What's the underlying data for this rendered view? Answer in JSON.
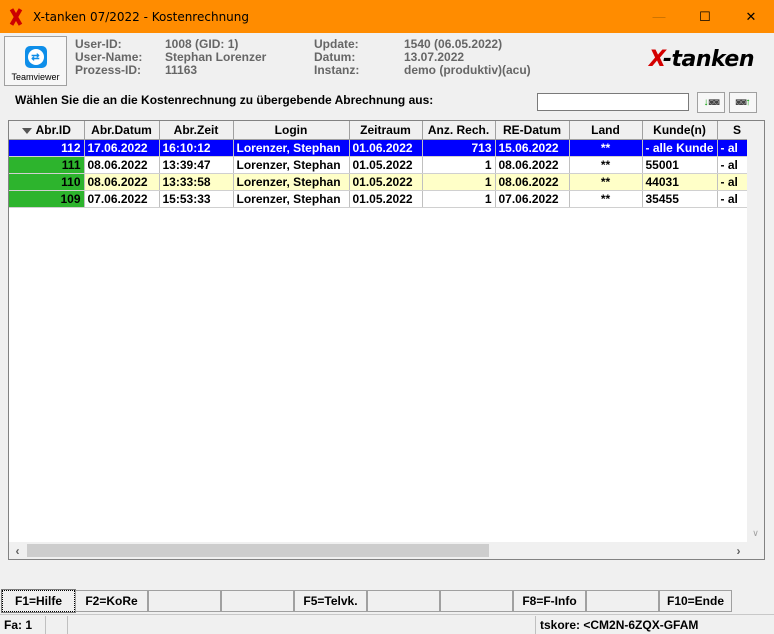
{
  "window": {
    "title": "X-tanken 07/2022 - Kostenrechnung",
    "minimize": "—",
    "maximize": "☐",
    "close": "✕"
  },
  "header": {
    "teamviewer_label": "Teamviewer",
    "user_id_label": "User-ID:",
    "user_id": "1008 (GID: 1)",
    "user_name_label": "User-Name:",
    "user_name": "Stephan Lorenzer",
    "process_id_label": "Prozess-ID:",
    "process_id": "11163",
    "update_label": "Update:",
    "update": "1540 (06.05.2022)",
    "date_label": "Datum:",
    "date": "13.07.2022",
    "instance_label": "Instanz:",
    "instance": "demo (produktiv)(acu)",
    "brand_x": "X",
    "brand_rest": "-tanken"
  },
  "prompt": {
    "text": "Wählen Sie die an die Kostenrechnung zu übergebende Abrechnung aus:",
    "search_value": ""
  },
  "grid": {
    "columns": [
      "Abr.ID",
      "Abr.Datum",
      "Abr.Zeit",
      "Login",
      "Zeitraum",
      "Anz. Rech.",
      "RE-Datum",
      "Land",
      "Kunde(n)",
      "S"
    ],
    "rows": [
      [
        "112",
        "17.06.2022",
        "16:10:12",
        "Lorenzer, Stephan",
        "01.06.2022",
        "713",
        "15.06.2022",
        "**",
        "- alle Kunde",
        "- al"
      ],
      [
        "111",
        "08.06.2022",
        "13:39:47",
        "Lorenzer, Stephan",
        "01.05.2022",
        "1",
        "08.06.2022",
        "**",
        "55001",
        "- al"
      ],
      [
        "110",
        "08.06.2022",
        "13:33:58",
        "Lorenzer, Stephan",
        "01.05.2022",
        "1",
        "08.06.2022",
        "**",
        "44031",
        "- al"
      ],
      [
        "109",
        "07.06.2022",
        "15:53:33",
        "Lorenzer, Stephan",
        "01.05.2022",
        "1",
        "07.06.2022",
        "**",
        "35455",
        "- al"
      ]
    ]
  },
  "fkeys": [
    "F1=Hilfe",
    "F2=KoRe",
    "",
    "",
    "F5=Telvk.",
    "",
    "",
    "F8=F-Info",
    "",
    "F10=Ende"
  ],
  "status": {
    "field": "Fa: 1",
    "info": "tskore: <CM2N-6ZQX-GFAM"
  }
}
